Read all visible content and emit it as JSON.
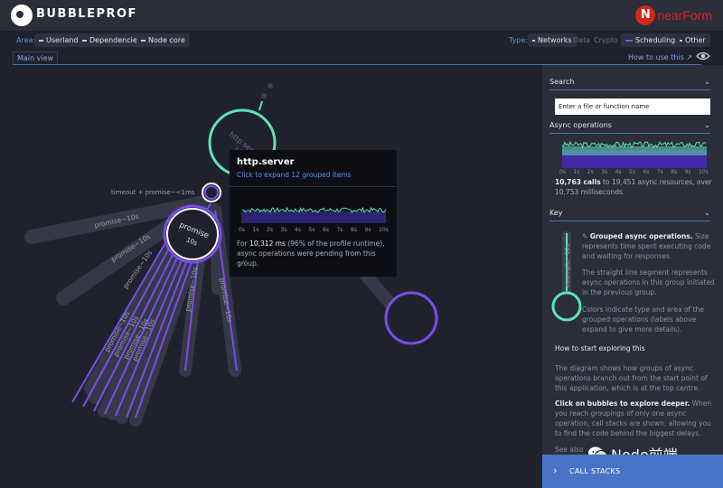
{
  "header": {
    "app_name": "BUBBLEPROF",
    "brand_logo_mark": "N",
    "brand_logo_text": "nearForm"
  },
  "toolbar": {
    "area_label": "Area:",
    "area_items": [
      "Userland",
      "Dependencies",
      "Node core"
    ],
    "type_label": "Type:",
    "type_items": [
      "Networks",
      "Data",
      "Crypto",
      "Scheduling",
      "Other"
    ]
  },
  "tabs": {
    "main": "Main view",
    "howto": "How to use this"
  },
  "diagram": {
    "labels": {
      "timeout": "timeout + promise~<1ms",
      "promise_main": "promise",
      "promise_main_dur": "10s",
      "http_server_dur": "10s",
      "p1": "promise~10s",
      "p2": "promise~10s",
      "p3": "promise~10s",
      "p4": "promise~10s",
      "p5": "promise~10s",
      "p6": "promise~10s",
      "p7": "promise~10s",
      "p8": "promise~10s",
      "p9": "promise~10s"
    }
  },
  "tooltip": {
    "title": "http.server",
    "link": "Click to expand 12 grouped items",
    "ticks": [
      "0s",
      "1s",
      "2s",
      "3s",
      "4s",
      "5s",
      "6s",
      "7s",
      "8s",
      "9s",
      "10s"
    ],
    "text_pre": "For ",
    "text_ms": "10,312 ms",
    "text_post": " (96% of the profile runtime), async operations were pending from this group."
  },
  "panel": {
    "search_title": "Search",
    "search_placeholder": "Enter a file or function name",
    "async_title": "Async operations",
    "async_ticks": [
      "0s",
      "1s",
      "2s",
      "3s",
      "4s",
      "5s",
      "6s",
      "7s",
      "8s",
      "9s",
      "10s"
    ],
    "async_calls": "10,763 calls",
    "async_summary_rest": " to 19,451 async resources, over 10,753 milliseconds.",
    "key_title": "Key",
    "key_example_label": "example~12s",
    "key_p1_bold": "Grouped async operations.",
    "key_p1_rest": " Size represents time spent executing code and waiting for responses.",
    "key_p2": "The straight line segment represents async operations in this group initiated in the previous group.",
    "key_p3": "Colors indicate type and area of the grouped operations (labels above expand to give more details).",
    "explore_title": "How to start exploring this",
    "explore_p1": "The diagram shows how groups of async operations branch out from the start point of this application, which is at the top centre.",
    "explore_p2_bold": "Click on bubbles to explore deeper.",
    "explore_p2_rest": " When you reach groupings of only one async operation, call stacks are shown, allowing you to find the code behind the biggest delays.",
    "explore_p3": "See also",
    "callstacks": "CALL STACKS"
  },
  "watermark": {
    "text": "Node前端"
  },
  "colors": {
    "background": "#1f222d",
    "panel": "#2a2d3a",
    "accent_blue": "#4a73c7",
    "scheduling_purple": "#7c4bea",
    "network_green": "#5fe3b3",
    "brand_red": "#d0271d"
  }
}
